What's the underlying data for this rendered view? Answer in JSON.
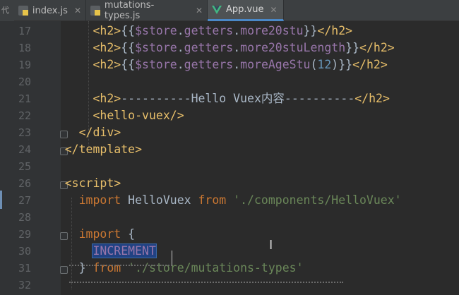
{
  "tabs": [
    {
      "label": "index.js",
      "icon": "js-file-icon",
      "active": false
    },
    {
      "label": "mutations-types.js",
      "icon": "js-file-icon",
      "active": false
    },
    {
      "label": "App.vue",
      "icon": "vue-file-icon",
      "active": true
    }
  ],
  "gutter_stub": "代",
  "editor": {
    "line_numbers": [
      "17",
      "18",
      "19",
      "20",
      "21",
      "22",
      "23",
      "24",
      "25",
      "26",
      "27",
      "28",
      "29",
      "30",
      "31",
      "32"
    ],
    "lines": [
      {
        "ln": "17",
        "tokens": [
          {
            "t": "        "
          },
          {
            "t": "<h2>",
            "c": "tag"
          },
          {
            "t": "{{",
            "c": "punct"
          },
          {
            "t": "$store",
            "c": "obj"
          },
          {
            "t": ".",
            "c": "punct"
          },
          {
            "t": "getters",
            "c": "prop"
          },
          {
            "t": ".",
            "c": "punct"
          },
          {
            "t": "more20stu",
            "c": "prop"
          },
          {
            "t": "}}",
            "c": "punct"
          },
          {
            "t": "</h2>",
            "c": "tag"
          }
        ]
      },
      {
        "ln": "18",
        "tokens": [
          {
            "t": "        "
          },
          {
            "t": "<h2>",
            "c": "tag"
          },
          {
            "t": "{{",
            "c": "punct"
          },
          {
            "t": "$store",
            "c": "obj"
          },
          {
            "t": ".",
            "c": "punct"
          },
          {
            "t": "getters",
            "c": "prop"
          },
          {
            "t": ".",
            "c": "punct"
          },
          {
            "t": "more20stuLength",
            "c": "prop"
          },
          {
            "t": "}}",
            "c": "punct"
          },
          {
            "t": "</h2>",
            "c": "tag"
          }
        ]
      },
      {
        "ln": "19",
        "tokens": [
          {
            "t": "        "
          },
          {
            "t": "<h2>",
            "c": "tag"
          },
          {
            "t": "{{",
            "c": "punct"
          },
          {
            "t": "$store",
            "c": "obj"
          },
          {
            "t": ".",
            "c": "punct"
          },
          {
            "t": "getters",
            "c": "prop"
          },
          {
            "t": ".",
            "c": "punct"
          },
          {
            "t": "moreAgeStu",
            "c": "prop"
          },
          {
            "t": "(",
            "c": "punct"
          },
          {
            "t": "12",
            "c": "num"
          },
          {
            "t": ")",
            "c": "punct"
          },
          {
            "t": "}}",
            "c": "punct"
          },
          {
            "t": "</h2>",
            "c": "tag"
          }
        ]
      },
      {
        "ln": "20",
        "tokens": []
      },
      {
        "ln": "21",
        "tokens": [
          {
            "t": "        "
          },
          {
            "t": "<h2>",
            "c": "tag"
          },
          {
            "t": "----------Hello Vuex内容----------",
            "c": "ident"
          },
          {
            "t": "</h2>",
            "c": "tag"
          }
        ]
      },
      {
        "ln": "22",
        "tokens": [
          {
            "t": "        "
          },
          {
            "t": "<hello-vuex/>",
            "c": "tag"
          }
        ]
      },
      {
        "ln": "23",
        "tokens": [
          {
            "t": "      "
          },
          {
            "t": "</div>",
            "c": "tag"
          }
        ]
      },
      {
        "ln": "24",
        "tokens": [
          {
            "t": "    "
          },
          {
            "t": "</template>",
            "c": "tag"
          }
        ]
      },
      {
        "ln": "25",
        "tokens": []
      },
      {
        "ln": "26",
        "tokens": [
          {
            "t": "    "
          },
          {
            "t": "<script>",
            "c": "tag"
          }
        ]
      },
      {
        "ln": "27",
        "tokens": [
          {
            "t": "      "
          },
          {
            "t": "import",
            "c": "kw"
          },
          {
            "t": " HelloVuex ",
            "c": "ident"
          },
          {
            "t": "from",
            "c": "kw"
          },
          {
            "t": " ",
            "c": "ident"
          },
          {
            "t": "'./components/HelloVuex'",
            "c": "str"
          }
        ]
      },
      {
        "ln": "28",
        "tokens": []
      },
      {
        "ln": "29",
        "tokens": [
          {
            "t": "      "
          },
          {
            "t": "import",
            "c": "kw"
          },
          {
            "t": " {",
            "c": "ident"
          }
        ]
      },
      {
        "ln": "30",
        "tokens": [
          {
            "t": "        "
          },
          {
            "t": "INCREMENT",
            "c": "sel"
          }
        ]
      },
      {
        "ln": "31",
        "tokens": [
          {
            "t": "      "
          },
          {
            "t": "} ",
            "c": "ident"
          },
          {
            "t": "from",
            "c": "kw"
          },
          {
            "t": " ",
            "c": "ident"
          },
          {
            "t": "'./store/mutations-types'",
            "c": "str"
          }
        ]
      },
      {
        "ln": "32",
        "tokens": []
      }
    ]
  },
  "colors": {
    "background": "#2b2b2b",
    "gutter": "#313335",
    "tag": "#e8bf6a",
    "keyword": "#cc7832",
    "string": "#6a8759",
    "property": "#9876aa",
    "number": "#6897bb",
    "selection": "#214283",
    "tab_active_underline": "#4a88c7"
  }
}
